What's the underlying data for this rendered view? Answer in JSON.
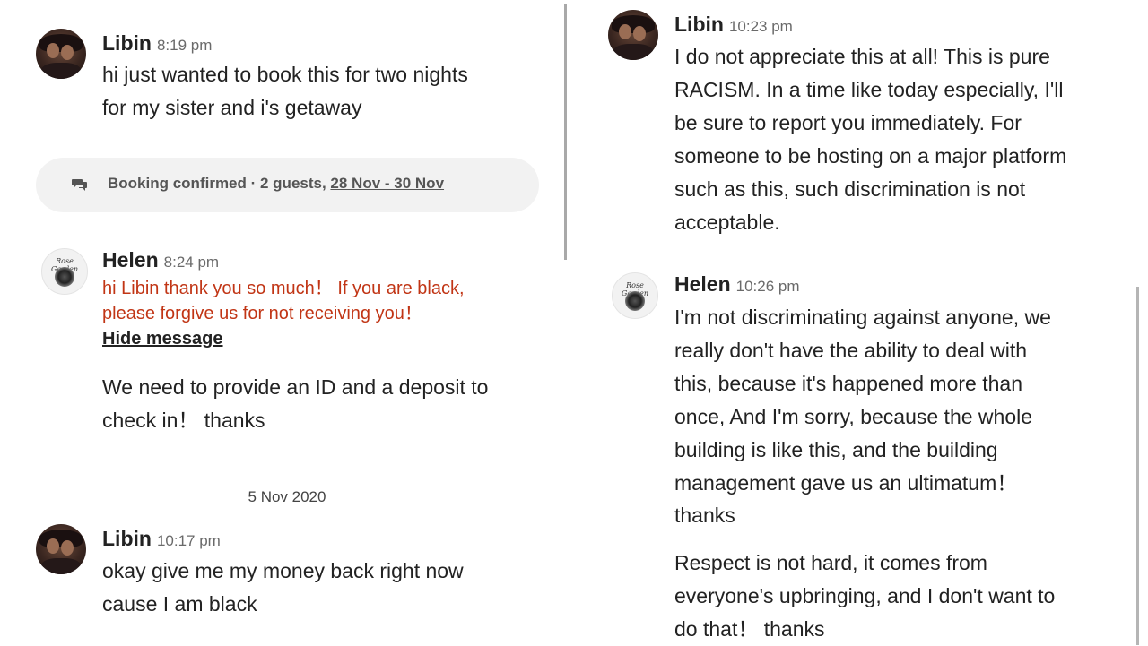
{
  "left": {
    "msg1": {
      "name": "Libin",
      "time": "8:19 pm",
      "lines": [
        "hi just wanted to book this for two nights",
        "for my sister and i's getaway"
      ]
    },
    "booking": {
      "status": "Booking confirmed · 2 guests, ",
      "dates": "28 Nov - 30 Nov",
      "icon": "chat-bubbles-icon"
    },
    "msg2": {
      "name": "Helen",
      "time": "8:24 pm",
      "flagged_lines": [
        "hi Libin thank you so much！ If you are black,",
        "please forgive us for not receiving you！"
      ],
      "hide_label": "Hide message",
      "lines": [
        "We need to provide an ID and a deposit to",
        "check in！ thanks"
      ]
    },
    "date_separator": "5 Nov 2020",
    "msg3": {
      "name": "Libin",
      "time": "10:17 pm",
      "lines": [
        "okay give me my money back right now",
        "cause I am black"
      ]
    }
  },
  "right": {
    "msg1": {
      "name": "Libin",
      "time": "10:23 pm",
      "lines": [
        "I do not appreciate this at all! This is pure",
        "RACISM. In a time like today especially, I'll",
        "be sure to report you immediately.  For",
        "someone to be hosting on a major platform",
        "such as this, such discrimination is not",
        "acceptable."
      ]
    },
    "msg2": {
      "name": "Helen",
      "time": "10:26 pm",
      "lines": [
        "I'm not discriminating against anyone, we",
        "really don't have the ability to deal with",
        "this, because it's happened more than",
        "once, And I'm sorry, because the whole",
        "building is like this, and the building",
        "management gave us an ultimatum！",
        "thanks"
      ],
      "lines2": [
        "Respect is not hard, it comes from",
        "everyone's upbringing, and I don't want to",
        "do that！ thanks"
      ]
    }
  },
  "colors": {
    "flagged_text": "#c13515",
    "booking_bg": "#f2f2f2",
    "divider": "#a9a9a9"
  }
}
